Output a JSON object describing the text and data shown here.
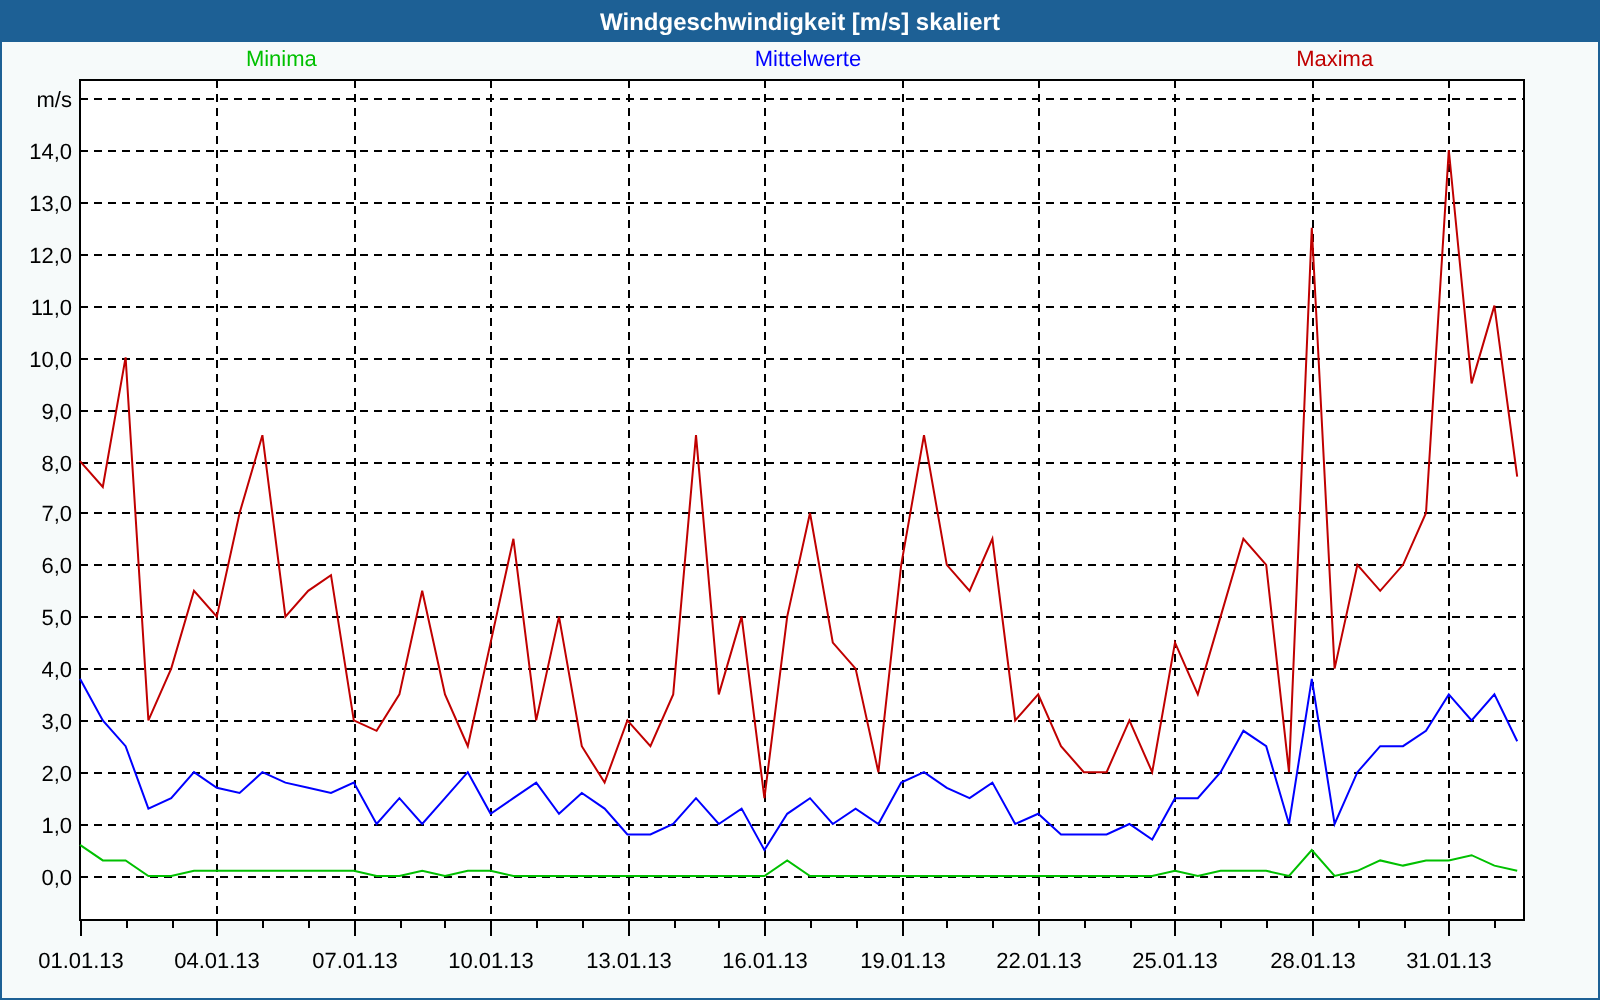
{
  "window": {
    "title": "Windgeschwindigkeit [m/s] skaliert"
  },
  "chart": {
    "chart_data": {
      "type": "line",
      "grid": true,
      "ylabel": "m/s",
      "ylim": [
        -0.85,
        15.35
      ],
      "yticks": [
        {
          "value": 0,
          "label": "0,0"
        },
        {
          "value": 1,
          "label": "1,0"
        },
        {
          "value": 2,
          "label": "2,0"
        },
        {
          "value": 3,
          "label": "3,0"
        },
        {
          "value": 4,
          "label": "4,0"
        },
        {
          "value": 5,
          "label": "5,0"
        },
        {
          "value": 6,
          "label": "6,0"
        },
        {
          "value": 7,
          "label": "7,0"
        },
        {
          "value": 8,
          "label": "8,0"
        },
        {
          "value": 9,
          "label": "9,0"
        },
        {
          "value": 10,
          "label": "10,0"
        },
        {
          "value": 11,
          "label": "11,0"
        },
        {
          "value": 12,
          "label": "12,0"
        },
        {
          "value": 13,
          "label": "13,0"
        },
        {
          "value": 14,
          "label": "14,0"
        }
      ],
      "categories": [
        "01.01.13",
        null,
        null,
        null,
        null,
        null,
        "04.01.13",
        null,
        null,
        null,
        null,
        null,
        "07.01.13",
        null,
        null,
        null,
        null,
        null,
        "10.01.13",
        null,
        null,
        null,
        null,
        null,
        "13.01.13",
        null,
        null,
        null,
        null,
        null,
        "16.01.13",
        null,
        null,
        null,
        null,
        null,
        "19.01.13",
        null,
        null,
        null,
        null,
        null,
        "22.01.13",
        null,
        null,
        null,
        null,
        null,
        "25.01.13",
        null,
        null,
        null,
        null,
        null,
        "28.01.13",
        null,
        null,
        null,
        null,
        null,
        "31.01.13",
        null,
        null,
        null
      ],
      "series": [
        {
          "name": "Minima",
          "color": "#00c000",
          "values": [
            0.6,
            0.3,
            0.3,
            0.0,
            0.0,
            0.1,
            0.1,
            0.1,
            0.1,
            0.1,
            0.1,
            0.1,
            0.1,
            0.0,
            0.0,
            0.1,
            0.0,
            0.1,
            0.1,
            0.0,
            0.0,
            0.0,
            0.0,
            0.0,
            0.0,
            0.0,
            0.0,
            0.0,
            0.0,
            0.0,
            0.0,
            0.3,
            0.0,
            0.0,
            0.0,
            0.0,
            0.0,
            0.0,
            0.0,
            0.0,
            0.0,
            0.0,
            0.0,
            0.0,
            0.0,
            0.0,
            0.0,
            0.0,
            0.1,
            0.0,
            0.1,
            0.1,
            0.1,
            0.0,
            0.5,
            0.0,
            0.1,
            0.3,
            0.2,
            0.3,
            0.3,
            0.4,
            0.2,
            0.1
          ]
        },
        {
          "name": "Mittelwerte",
          "color": "#0000ff",
          "values": [
            3.8,
            3.0,
            2.5,
            1.3,
            1.5,
            2.0,
            1.7,
            1.6,
            2.0,
            1.8,
            1.7,
            1.6,
            1.8,
            1.0,
            1.5,
            1.0,
            1.5,
            2.0,
            1.2,
            1.5,
            1.8,
            1.2,
            1.6,
            1.3,
            0.8,
            0.8,
            1.0,
            1.5,
            1.0,
            1.3,
            0.5,
            1.2,
            1.5,
            1.0,
            1.3,
            1.0,
            1.8,
            2.0,
            1.7,
            1.5,
            1.8,
            1.0,
            1.2,
            0.8,
            0.8,
            0.8,
            1.0,
            0.7,
            1.5,
            1.5,
            2.0,
            2.8,
            2.5,
            1.0,
            3.8,
            1.0,
            2.0,
            2.5,
            2.5,
            2.8,
            3.5,
            3.0,
            3.5,
            2.6
          ]
        },
        {
          "name": "Maxima",
          "color": "#c00000",
          "values": [
            8.0,
            7.5,
            10.0,
            3.0,
            4.0,
            5.5,
            5.0,
            7.0,
            8.5,
            5.0,
            5.5,
            5.8,
            3.0,
            2.8,
            3.5,
            5.5,
            3.5,
            2.5,
            4.5,
            6.5,
            3.0,
            5.0,
            2.5,
            1.8,
            3.0,
            2.5,
            3.5,
            8.5,
            3.5,
            5.0,
            1.5,
            5.0,
            7.0,
            4.5,
            4.0,
            2.0,
            6.0,
            8.5,
            6.0,
            5.5,
            6.5,
            3.0,
            3.5,
            2.5,
            2.0,
            2.0,
            3.0,
            2.0,
            4.5,
            3.5,
            5.0,
            6.5,
            6.0,
            2.0,
            12.5,
            4.0,
            6.0,
            5.5,
            6.0,
            7.0,
            14.0,
            9.5,
            11.0,
            7.7
          ]
        }
      ]
    }
  }
}
